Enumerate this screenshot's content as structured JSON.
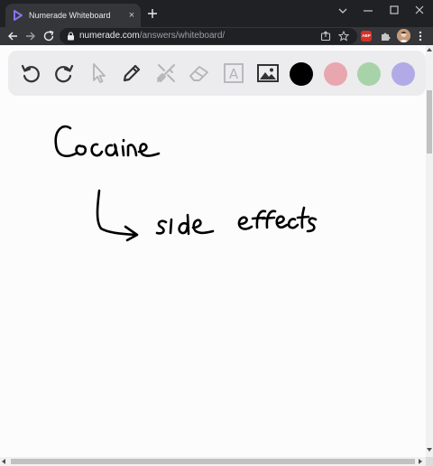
{
  "browser": {
    "tab_title": "Numerade Whiteboard",
    "tab_close": "×",
    "url_host": "numerade.com",
    "url_path": "/answers/whiteboard/",
    "extension_badge": "ABP"
  },
  "whiteboard": {
    "tools": [
      {
        "name": "undo-icon",
        "enabled": true
      },
      {
        "name": "redo-icon",
        "enabled": true
      },
      {
        "name": "cursor-icon",
        "enabled": false
      },
      {
        "name": "pen-icon",
        "enabled": true
      },
      {
        "name": "tools-icon",
        "enabled": false
      },
      {
        "name": "eraser-icon",
        "enabled": false
      },
      {
        "name": "text-icon",
        "enabled": false
      },
      {
        "name": "image-icon",
        "enabled": true
      }
    ],
    "text_tool_glyph": "A",
    "colors": [
      "#000000",
      "#e8a7ae",
      "#a8d3a9",
      "#b0abe6"
    ],
    "accent": "#8c70f0"
  },
  "canvas": {
    "handwriting": [
      "Cocaine",
      "side effects"
    ]
  }
}
